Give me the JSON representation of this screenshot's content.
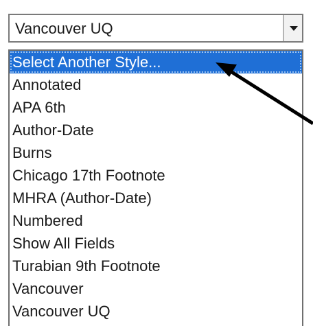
{
  "combo": {
    "value": "Vancouver UQ",
    "button_icon": "chevron-down-icon"
  },
  "dropdown": {
    "items": [
      {
        "label": "Select Another Style...",
        "selected": true
      },
      {
        "label": "Annotated",
        "selected": false
      },
      {
        "label": "APA 6th",
        "selected": false
      },
      {
        "label": "Author-Date",
        "selected": false
      },
      {
        "label": "Burns",
        "selected": false
      },
      {
        "label": "Chicago 17th Footnote",
        "selected": false
      },
      {
        "label": "MHRA (Author-Date)",
        "selected": false
      },
      {
        "label": "Numbered",
        "selected": false
      },
      {
        "label": "Show All Fields",
        "selected": false
      },
      {
        "label": "Turabian 9th Footnote",
        "selected": false
      },
      {
        "label": "Vancouver",
        "selected": false
      },
      {
        "label": "Vancouver UQ",
        "selected": false
      }
    ]
  },
  "annotation": {
    "icon": "arrow-pointer-icon",
    "color": "#000000"
  },
  "colors": {
    "selection": "#1f6fd6",
    "selection_text": "#ffffff",
    "text": "#1a1a1a"
  }
}
